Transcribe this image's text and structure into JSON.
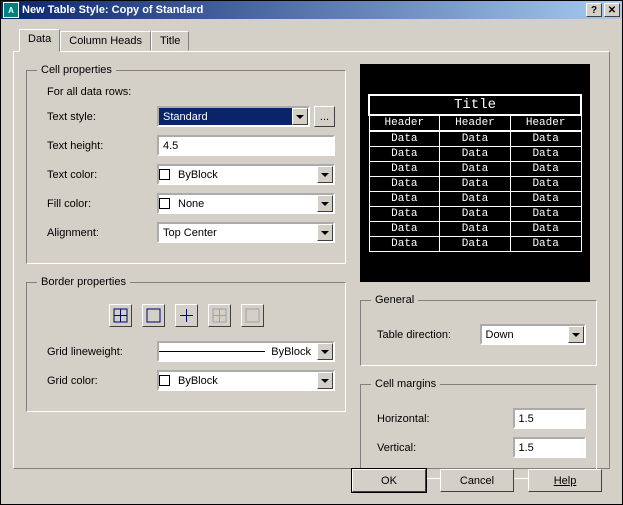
{
  "window": {
    "title": "New Table Style: Copy of Standard"
  },
  "tabs": {
    "data": "Data",
    "column_heads": "Column Heads",
    "title": "Title"
  },
  "cell_props": {
    "legend": "Cell properties",
    "subhead": "For all data rows:",
    "text_style_label": "Text style:",
    "text_style_value": "Standard",
    "text_height_label": "Text height:",
    "text_height_value": "4.5",
    "text_color_label": "Text color:",
    "text_color_value": "ByBlock",
    "fill_color_label": "Fill color:",
    "fill_color_value": "None",
    "alignment_label": "Alignment:",
    "alignment_value": "Top Center",
    "dots": "..."
  },
  "border_props": {
    "legend": "Border properties",
    "grid_lw_label": "Grid lineweight:",
    "grid_lw_value": "ByBlock",
    "grid_color_label": "Grid color:",
    "grid_color_value": "ByBlock"
  },
  "preview": {
    "title": "Title",
    "header": "Header",
    "data": "Data"
  },
  "general": {
    "legend": "General",
    "direction_label": "Table direction:",
    "direction_value": "Down"
  },
  "cell_margins": {
    "legend": "Cell margins",
    "h_label": "Horizontal:",
    "h_value": "1.5",
    "v_label": "Vertical:",
    "v_value": "1.5"
  },
  "buttons": {
    "ok": "OK",
    "cancel": "Cancel",
    "help": "Help"
  }
}
